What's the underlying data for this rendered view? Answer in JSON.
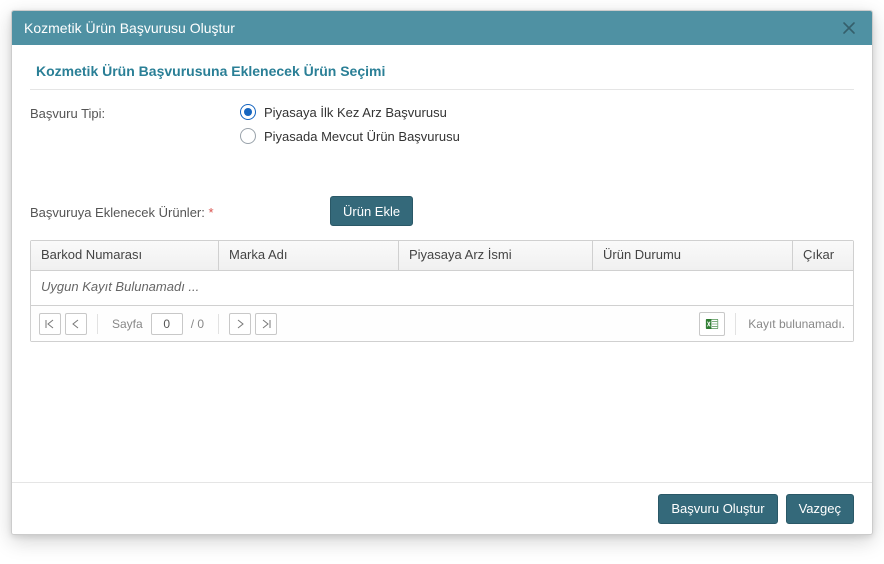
{
  "modal": {
    "title": "Kozmetik Ürün Başvurusu Oluştur",
    "section_title": "Kozmetik Ürün Başvurusuna Eklenecek Ürün Seçimi"
  },
  "form": {
    "type_label": "Başvuru Tipi:",
    "radio_first": "Piyasaya İlk Kez Arz Başvurusu",
    "radio_existing": "Piyasada Mevcut Ürün Başvurusu",
    "products_label": "Başvuruya Eklenecek Ürünler:",
    "required_mark": "*",
    "add_button": "Ürün Ekle"
  },
  "grid": {
    "columns": {
      "barcode": "Barkod Numarası",
      "brand": "Marka Adı",
      "market_name": "Piyasaya Arz İsmi",
      "status": "Ürün Durumu",
      "remove": "Çıkar"
    },
    "empty_text": "Uygun Kayıt Bulunamadı ...",
    "pager": {
      "page_label": "Sayfa",
      "page_value": "0",
      "total_pages": "/ 0",
      "status": "Kayıt bulunamadı."
    }
  },
  "footer": {
    "create": "Başvuru Oluştur",
    "cancel": "Vazgeç"
  }
}
